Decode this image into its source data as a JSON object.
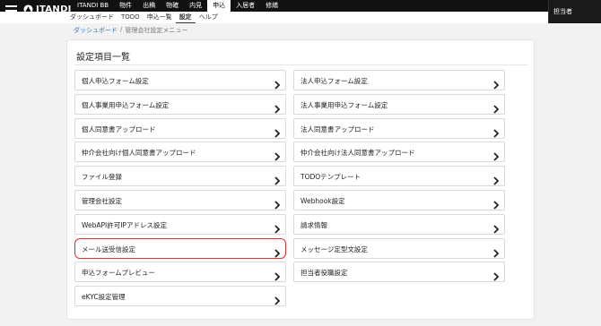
{
  "topbar": {
    "logo_text": "ITANDI",
    "main_nav": [
      "ITANDI BB",
      "物件",
      "出稿",
      "物確",
      "内見",
      "申込",
      "入居者",
      "修繕"
    ],
    "active_main": "申込",
    "user": "担当者"
  },
  "subnav": {
    "items": [
      "ダッシュボード",
      "TODO",
      "申込一覧",
      "設定",
      "ヘルプ"
    ],
    "active": "設定"
  },
  "breadcrumb": {
    "home": "ダッシュボード",
    "separator": "/",
    "current": "管理会社設定メニュー"
  },
  "card": {
    "title": "設定項目一覧",
    "left_items": [
      "個人申込フォーム設定",
      "個人事業用申込フォーム設定",
      "個人同意書アップロード",
      "仲介会社向け個人同意書アップロード",
      "ファイル登録",
      "管理会社設定",
      "WebAPI許可IPアドレス設定",
      "メール送受信設定",
      "申込フォームプレビュー",
      "eKYC設定管理"
    ],
    "right_items": [
      "法人申込フォーム設定",
      "法人事業用申込フォーム設定",
      "法人同意書アップロード",
      "仲介会社向け法人同意書アップロード",
      "TODOテンプレート",
      "Webhook設定",
      "請求情報",
      "メッセージ定型文設定",
      "担当者役職設定"
    ],
    "highlighted_item": "メール送受信設定",
    "highlight_color": "#e03030"
  }
}
